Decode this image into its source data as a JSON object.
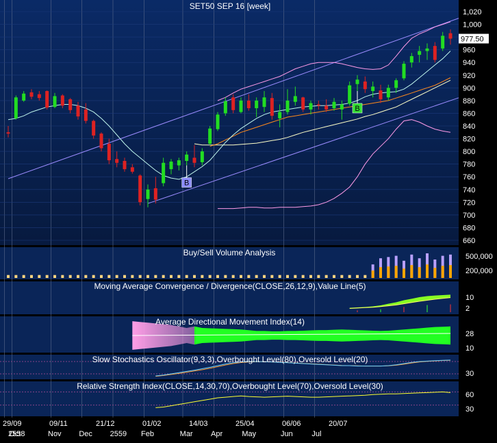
{
  "chart_data": [
    {
      "type": "candlestick",
      "title": "SET50 SEP 16   [week]",
      "last_price_label": "977.50",
      "ylim": [
        650,
        1025
      ],
      "yticks": [
        "1,020",
        "1,000",
        "980",
        "960",
        "940",
        "920",
        "900",
        "880",
        "860",
        "840",
        "820",
        "800",
        "780",
        "760",
        "740",
        "720",
        "700",
        "680",
        "660"
      ],
      "ytick_values": [
        1020,
        1000,
        980,
        960,
        940,
        920,
        900,
        880,
        860,
        840,
        820,
        800,
        780,
        760,
        740,
        720,
        700,
        680,
        660
      ],
      "candles": [
        {
          "o": 830,
          "h": 840,
          "l": 822,
          "c": 828
        },
        {
          "o": 852,
          "h": 888,
          "l": 850,
          "c": 885
        },
        {
          "o": 880,
          "h": 895,
          "l": 878,
          "c": 891
        },
        {
          "o": 893,
          "h": 898,
          "l": 882,
          "c": 886
        },
        {
          "o": 890,
          "h": 895,
          "l": 880,
          "c": 884
        },
        {
          "o": 895,
          "h": 896,
          "l": 866,
          "c": 869
        },
        {
          "o": 870,
          "h": 892,
          "l": 868,
          "c": 887
        },
        {
          "o": 888,
          "h": 890,
          "l": 868,
          "c": 872
        },
        {
          "o": 882,
          "h": 884,
          "l": 860,
          "c": 865
        },
        {
          "o": 872,
          "h": 878,
          "l": 850,
          "c": 855
        },
        {
          "o": 866,
          "h": 876,
          "l": 844,
          "c": 848
        },
        {
          "o": 848,
          "h": 850,
          "l": 820,
          "c": 825
        },
        {
          "o": 828,
          "h": 830,
          "l": 800,
          "c": 805
        },
        {
          "o": 812,
          "h": 820,
          "l": 780,
          "c": 786
        },
        {
          "o": 788,
          "h": 800,
          "l": 775,
          "c": 782
        },
        {
          "o": 785,
          "h": 790,
          "l": 768,
          "c": 772
        },
        {
          "o": 775,
          "h": 780,
          "l": 765,
          "c": 768
        },
        {
          "o": 762,
          "h": 764,
          "l": 715,
          "c": 720
        },
        {
          "o": 725,
          "h": 748,
          "l": 712,
          "c": 740
        },
        {
          "o": 742,
          "h": 760,
          "l": 718,
          "c": 724
        },
        {
          "o": 750,
          "h": 790,
          "l": 745,
          "c": 782
        },
        {
          "o": 772,
          "h": 788,
          "l": 764,
          "c": 784
        },
        {
          "o": 778,
          "h": 790,
          "l": 770,
          "c": 786
        },
        {
          "o": 785,
          "h": 800,
          "l": 778,
          "c": 795
        },
        {
          "o": 790,
          "h": 810,
          "l": 775,
          "c": 782
        },
        {
          "o": 783,
          "h": 805,
          "l": 778,
          "c": 800
        },
        {
          "o": 812,
          "h": 840,
          "l": 810,
          "c": 836
        },
        {
          "o": 835,
          "h": 862,
          "l": 832,
          "c": 858
        },
        {
          "o": 860,
          "h": 885,
          "l": 856,
          "c": 879
        },
        {
          "o": 885,
          "h": 890,
          "l": 860,
          "c": 865
        },
        {
          "o": 862,
          "h": 885,
          "l": 860,
          "c": 880
        },
        {
          "o": 880,
          "h": 890,
          "l": 864,
          "c": 868
        },
        {
          "o": 868,
          "h": 885,
          "l": 854,
          "c": 880
        },
        {
          "o": 870,
          "h": 895,
          "l": 862,
          "c": 885
        },
        {
          "o": 884,
          "h": 892,
          "l": 850,
          "c": 856
        },
        {
          "o": 852,
          "h": 874,
          "l": 838,
          "c": 862
        },
        {
          "o": 862,
          "h": 898,
          "l": 858,
          "c": 880
        },
        {
          "o": 878,
          "h": 902,
          "l": 872,
          "c": 887
        },
        {
          "o": 885,
          "h": 886,
          "l": 862,
          "c": 866
        },
        {
          "o": 866,
          "h": 880,
          "l": 858,
          "c": 876
        },
        {
          "o": 874,
          "h": 880,
          "l": 866,
          "c": 872
        },
        {
          "o": 872,
          "h": 882,
          "l": 862,
          "c": 866
        },
        {
          "o": 868,
          "h": 884,
          "l": 864,
          "c": 878
        },
        {
          "o": 866,
          "h": 880,
          "l": 850,
          "c": 874
        },
        {
          "o": 875,
          "h": 910,
          "l": 872,
          "c": 904
        },
        {
          "o": 906,
          "h": 920,
          "l": 895,
          "c": 913
        },
        {
          "o": 910,
          "h": 918,
          "l": 892,
          "c": 898
        },
        {
          "o": 895,
          "h": 910,
          "l": 885,
          "c": 902
        },
        {
          "o": 896,
          "h": 905,
          "l": 876,
          "c": 882
        },
        {
          "o": 885,
          "h": 905,
          "l": 880,
          "c": 900
        },
        {
          "o": 900,
          "h": 915,
          "l": 892,
          "c": 912
        },
        {
          "o": 915,
          "h": 942,
          "l": 912,
          "c": 938
        },
        {
          "o": 940,
          "h": 955,
          "l": 932,
          "c": 950
        },
        {
          "o": 952,
          "h": 966,
          "l": 940,
          "c": 958
        },
        {
          "o": 958,
          "h": 970,
          "l": 944,
          "c": 962
        },
        {
          "o": 966,
          "h": 972,
          "l": 940,
          "c": 944
        },
        {
          "o": 962,
          "h": 988,
          "l": 958,
          "c": 982
        },
        {
          "o": 986,
          "h": 992,
          "l": 968,
          "c": 977.5
        }
      ],
      "markers": [
        {
          "label": "B",
          "index": 23
        },
        {
          "label": "B",
          "index": 45
        }
      ],
      "ma_fast": [
        850,
        852,
        856,
        862,
        866,
        870,
        872,
        874,
        874,
        872,
        868,
        862,
        852,
        840,
        826,
        812,
        800,
        790,
        780,
        770,
        762,
        758,
        756,
        760,
        768,
        776,
        786,
        800,
        814,
        826,
        836,
        844,
        852,
        858,
        862,
        864,
        866,
        868,
        870,
        871,
        872,
        872,
        873,
        874,
        876,
        880,
        886,
        890,
        892,
        893,
        894,
        898,
        906,
        916,
        926,
        936,
        946,
        958
      ],
      "ma_mid": [
        null,
        null,
        null,
        null,
        null,
        null,
        null,
        null,
        null,
        null,
        null,
        null,
        null,
        null,
        null,
        null,
        null,
        null,
        null,
        null,
        null,
        null,
        null,
        null,
        null,
        null,
        808,
        812,
        818,
        824,
        830,
        834,
        838,
        842,
        846,
        850,
        854,
        856,
        858,
        860,
        862,
        864,
        866,
        868,
        870,
        872,
        874,
        876,
        878,
        880,
        884,
        888,
        892,
        896,
        900,
        904,
        910,
        916
      ],
      "ma_slow": [
        null,
        null,
        null,
        null,
        null,
        null,
        null,
        null,
        null,
        null,
        null,
        null,
        null,
        null,
        null,
        null,
        null,
        null,
        null,
        null,
        null,
        null,
        null,
        null,
        812,
        810,
        810,
        810,
        810,
        810,
        811,
        812,
        813,
        815,
        817,
        819,
        822,
        826,
        830,
        833,
        836,
        839,
        842,
        845,
        848,
        851,
        855,
        858,
        862,
        866,
        870,
        876,
        882,
        888,
        894,
        900,
        906,
        912
      ],
      "bb_upper": [
        null,
        null,
        null,
        null,
        null,
        null,
        null,
        null,
        null,
        null,
        null,
        null,
        null,
        null,
        null,
        null,
        null,
        null,
        null,
        null,
        null,
        null,
        null,
        null,
        null,
        null,
        null,
        880,
        885,
        892,
        898,
        902,
        906,
        910,
        914,
        918,
        924,
        930,
        934,
        938,
        940,
        940,
        940,
        938,
        935,
        932,
        930,
        929,
        930,
        936,
        950,
        965,
        978,
        985,
        990,
        996,
        1000,
        1004
      ],
      "bb_lower": [
        null,
        null,
        null,
        null,
        null,
        null,
        null,
        null,
        null,
        null,
        null,
        null,
        null,
        null,
        null,
        null,
        null,
        null,
        null,
        null,
        null,
        null,
        null,
        null,
        null,
        null,
        null,
        710,
        710,
        710,
        711,
        712,
        712,
        711,
        711,
        712,
        712,
        712,
        713,
        714,
        716,
        720,
        726,
        734,
        744,
        760,
        780,
        796,
        808,
        820,
        835,
        848,
        850,
        846,
        840,
        835,
        832,
        830
      ],
      "channel_upper": [
        [
          0,
          757
        ],
        [
          57,
          1005
        ]
      ],
      "channel_lower": [
        [
          18,
          718
        ],
        [
          57,
          880
        ]
      ]
    },
    {
      "type": "bar",
      "title": "Buy/Sell Volume Analysis",
      "yticks": [
        "500,000",
        "200,000"
      ],
      "bars": [
        0.12,
        0.12,
        0.12,
        0.12,
        0.12,
        0.12,
        0.12,
        0.12,
        0.12,
        0.12,
        0.12,
        0.12,
        0.12,
        0.12,
        0.12,
        0.12,
        0.12,
        0.12,
        0.12,
        0.12,
        0.12,
        0.12,
        0.12,
        0.12,
        0.12,
        0.12,
        0.12,
        0.12,
        0.12,
        0.12,
        0.12,
        0.12,
        0.12,
        0.12,
        0.12,
        0.12,
        0.12,
        0.12,
        0.12,
        0.12,
        0.12,
        0.12,
        0.12,
        0.12,
        0.12,
        0.12,
        0.12,
        0.55,
        0.8,
        0.85,
        0.9,
        0.7,
        0.95,
        0.8,
        1.0,
        0.75,
        0.9,
        0.95
      ]
    },
    {
      "type": "area",
      "title": "Moving Average Convergence / Divergence(CLOSE,26,12,9),Value Line(5)",
      "yticks": [
        "10",
        "2"
      ],
      "macd": [
        null,
        null,
        null,
        null,
        null,
        null,
        null,
        null,
        null,
        null,
        null,
        null,
        null,
        null,
        null,
        null,
        null,
        null,
        null,
        null,
        null,
        null,
        null,
        null,
        null,
        null,
        null,
        null,
        null,
        null,
        null,
        null,
        null,
        null,
        null,
        null,
        null,
        null,
        null,
        null,
        null,
        null,
        null,
        null,
        0.18,
        0.2,
        0.22,
        0.25,
        0.3,
        0.38,
        0.45,
        0.55,
        0.62,
        0.7,
        0.75,
        0.78,
        0.8,
        0.82
      ],
      "signal": [
        null,
        null,
        null,
        null,
        null,
        null,
        null,
        null,
        null,
        null,
        null,
        null,
        null,
        null,
        null,
        null,
        null,
        null,
        null,
        null,
        null,
        null,
        null,
        null,
        null,
        null,
        null,
        null,
        null,
        null,
        null,
        null,
        null,
        null,
        null,
        null,
        null,
        null,
        null,
        null,
        null,
        null,
        null,
        null,
        0.15,
        0.17,
        0.19,
        0.21,
        0.24,
        0.28,
        0.32,
        0.38,
        0.44,
        0.5,
        0.55,
        0.6,
        0.64,
        0.68
      ]
    },
    {
      "type": "area",
      "title": "Average Directional Movement Index(14)",
      "yticks": [
        "28",
        "10"
      ],
      "neg_band_start": 16,
      "pos_band_start": 24,
      "adx_width": [
        0.0,
        0.0,
        0.0,
        0.0,
        0.0,
        0.0,
        0.0,
        0.0,
        0.0,
        0.0,
        0.0,
        0.0,
        0.0,
        0.0,
        0.0,
        0.0,
        0.95,
        0.9,
        0.85,
        0.8,
        0.75,
        0.7,
        0.6,
        0.5,
        0.6,
        0.5,
        0.48,
        0.46,
        0.44,
        0.42,
        0.4,
        0.35,
        0.3,
        0.3,
        0.28,
        0.28,
        0.3,
        0.3,
        0.32,
        0.34,
        0.36,
        0.36,
        0.38,
        0.4,
        0.38,
        0.36,
        0.34,
        0.32,
        0.3,
        0.32,
        0.36,
        0.4,
        0.44,
        0.48,
        0.52,
        0.56,
        0.58,
        0.6
      ]
    },
    {
      "type": "line",
      "title": "Slow Stochastics Oscillator(9,3,3),Overbought Level(80),Oversold Level(20)",
      "yticks": [
        "30"
      ],
      "k": [
        null,
        null,
        null,
        null,
        null,
        null,
        null,
        null,
        null,
        null,
        null,
        null,
        null,
        null,
        null,
        null,
        null,
        null,
        null,
        10,
        14,
        20,
        26,
        32,
        38,
        45,
        52,
        60,
        68,
        74,
        78,
        80,
        80,
        79,
        78,
        76,
        74,
        72,
        70,
        68,
        66,
        64,
        62,
        60,
        60,
        58,
        58,
        58,
        58,
        60,
        64,
        70,
        76,
        80,
        82,
        84,
        86,
        87
      ],
      "d": [
        null,
        null,
        null,
        null,
        null,
        null,
        null,
        null,
        null,
        null,
        null,
        null,
        null,
        null,
        null,
        null,
        null,
        null,
        null,
        8,
        12,
        17,
        22,
        28,
        34,
        40,
        47,
        55,
        63,
        70,
        75,
        78,
        79,
        79,
        78,
        77,
        75,
        73,
        71,
        69,
        67,
        65,
        63,
        61,
        60,
        59,
        58,
        58,
        58,
        59,
        62,
        67,
        73,
        78,
        81,
        83,
        85,
        86
      ]
    },
    {
      "type": "line",
      "title": "Relative Strength Index(CLOSE,14,30,70),Overbought Level(70),Oversold Level(30)",
      "yticks": [
        "60",
        "30"
      ],
      "rsi": [
        null,
        null,
        null,
        null,
        null,
        null,
        null,
        null,
        null,
        null,
        null,
        null,
        null,
        null,
        null,
        null,
        null,
        null,
        null,
        22,
        24,
        28,
        32,
        36,
        40,
        44,
        48,
        52,
        54,
        56,
        58,
        56,
        55,
        54,
        55,
        56,
        57,
        56,
        55,
        54,
        54,
        55,
        56,
        57,
        58,
        59,
        60,
        62,
        63,
        64,
        64,
        65,
        66,
        67,
        68,
        69,
        70,
        68
      ]
    },
    {
      "type": "axis",
      "top_labels": [
        "29/09",
        "09/11",
        "21/12",
        "01/02",
        "14/03",
        "25/04",
        "06/06",
        "20/07"
      ],
      "top_label_index": [
        0,
        6,
        12,
        18,
        24,
        30,
        36,
        42
      ],
      "bottom_labels": [
        "2558",
        "Oct",
        "Nov",
        "Dec",
        "2559",
        "Feb",
        "Mar",
        "Apr",
        "May",
        "Jun",
        "Jul"
      ],
      "bottom_label_index": [
        0,
        1,
        6,
        10,
        14,
        18,
        23,
        27,
        31,
        36,
        40
      ]
    }
  ],
  "colors": {
    "up": "#22dd22",
    "down": "#dd2222",
    "ma_fast": "#bff5ec",
    "ma_mid": "#ff8a1c",
    "ma_slow": "#ffffc8",
    "bollinger": "#ff9be8",
    "channel": "#9c8cff",
    "marker_b1": "#8c8cff",
    "marker_b2": "#33dd33"
  }
}
